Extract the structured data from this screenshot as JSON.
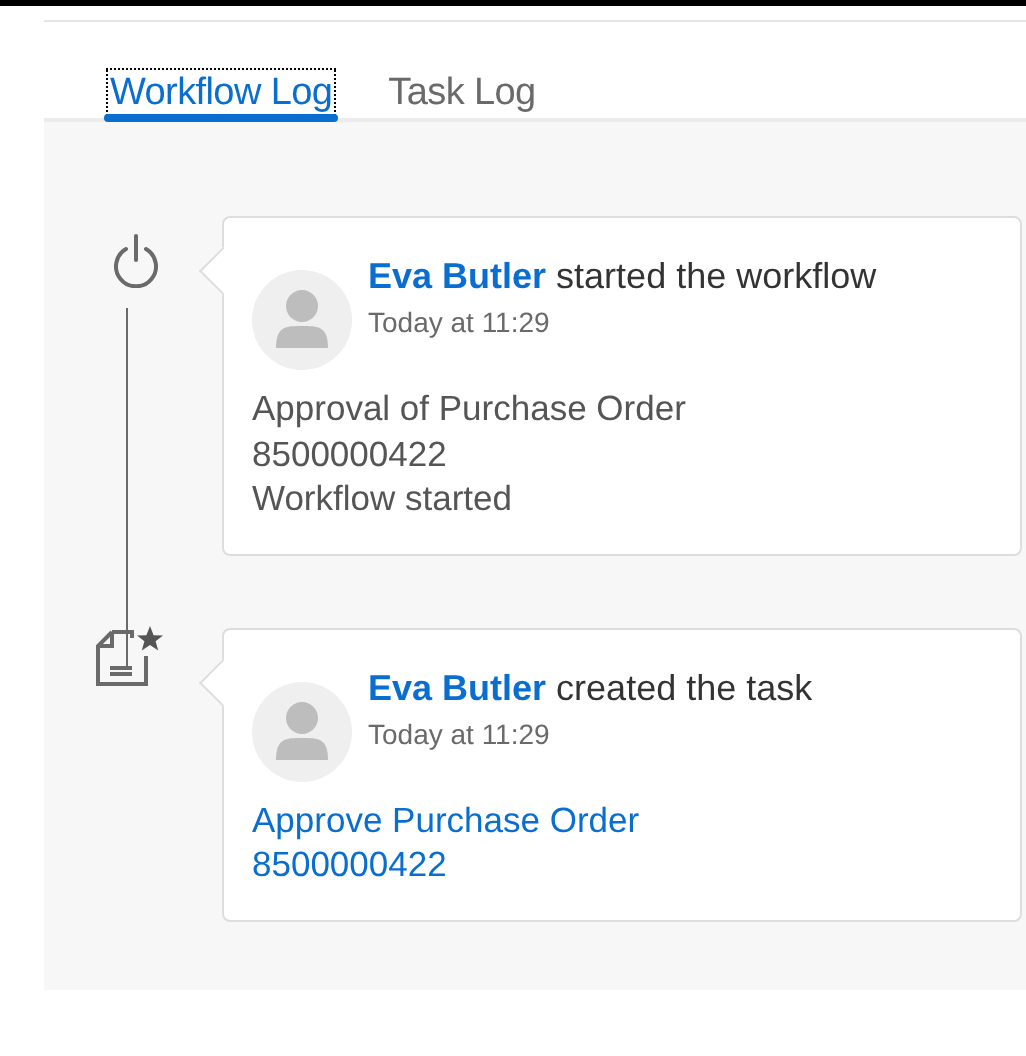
{
  "tabs": [
    {
      "label": "Workflow Log",
      "selected": true,
      "focused": true
    },
    {
      "label": "Task Log",
      "selected": false,
      "focused": false
    }
  ],
  "entries": [
    {
      "kind": "start",
      "actor": "Eva Butler",
      "action": "started the workflow",
      "time": "Today at 11:29",
      "details": [
        {
          "kind": "text",
          "text": "Approval of Purchase Order"
        },
        {
          "kind": "text",
          "text": "8500000422"
        },
        {
          "kind": "text",
          "text": "Workflow started"
        }
      ]
    },
    {
      "kind": "task",
      "actor": "Eva Butler",
      "action": "created the task",
      "time": "Today at 11:29",
      "details": [
        {
          "kind": "link",
          "text": "Approve Purchase Order 8500000422"
        }
      ]
    }
  ]
}
